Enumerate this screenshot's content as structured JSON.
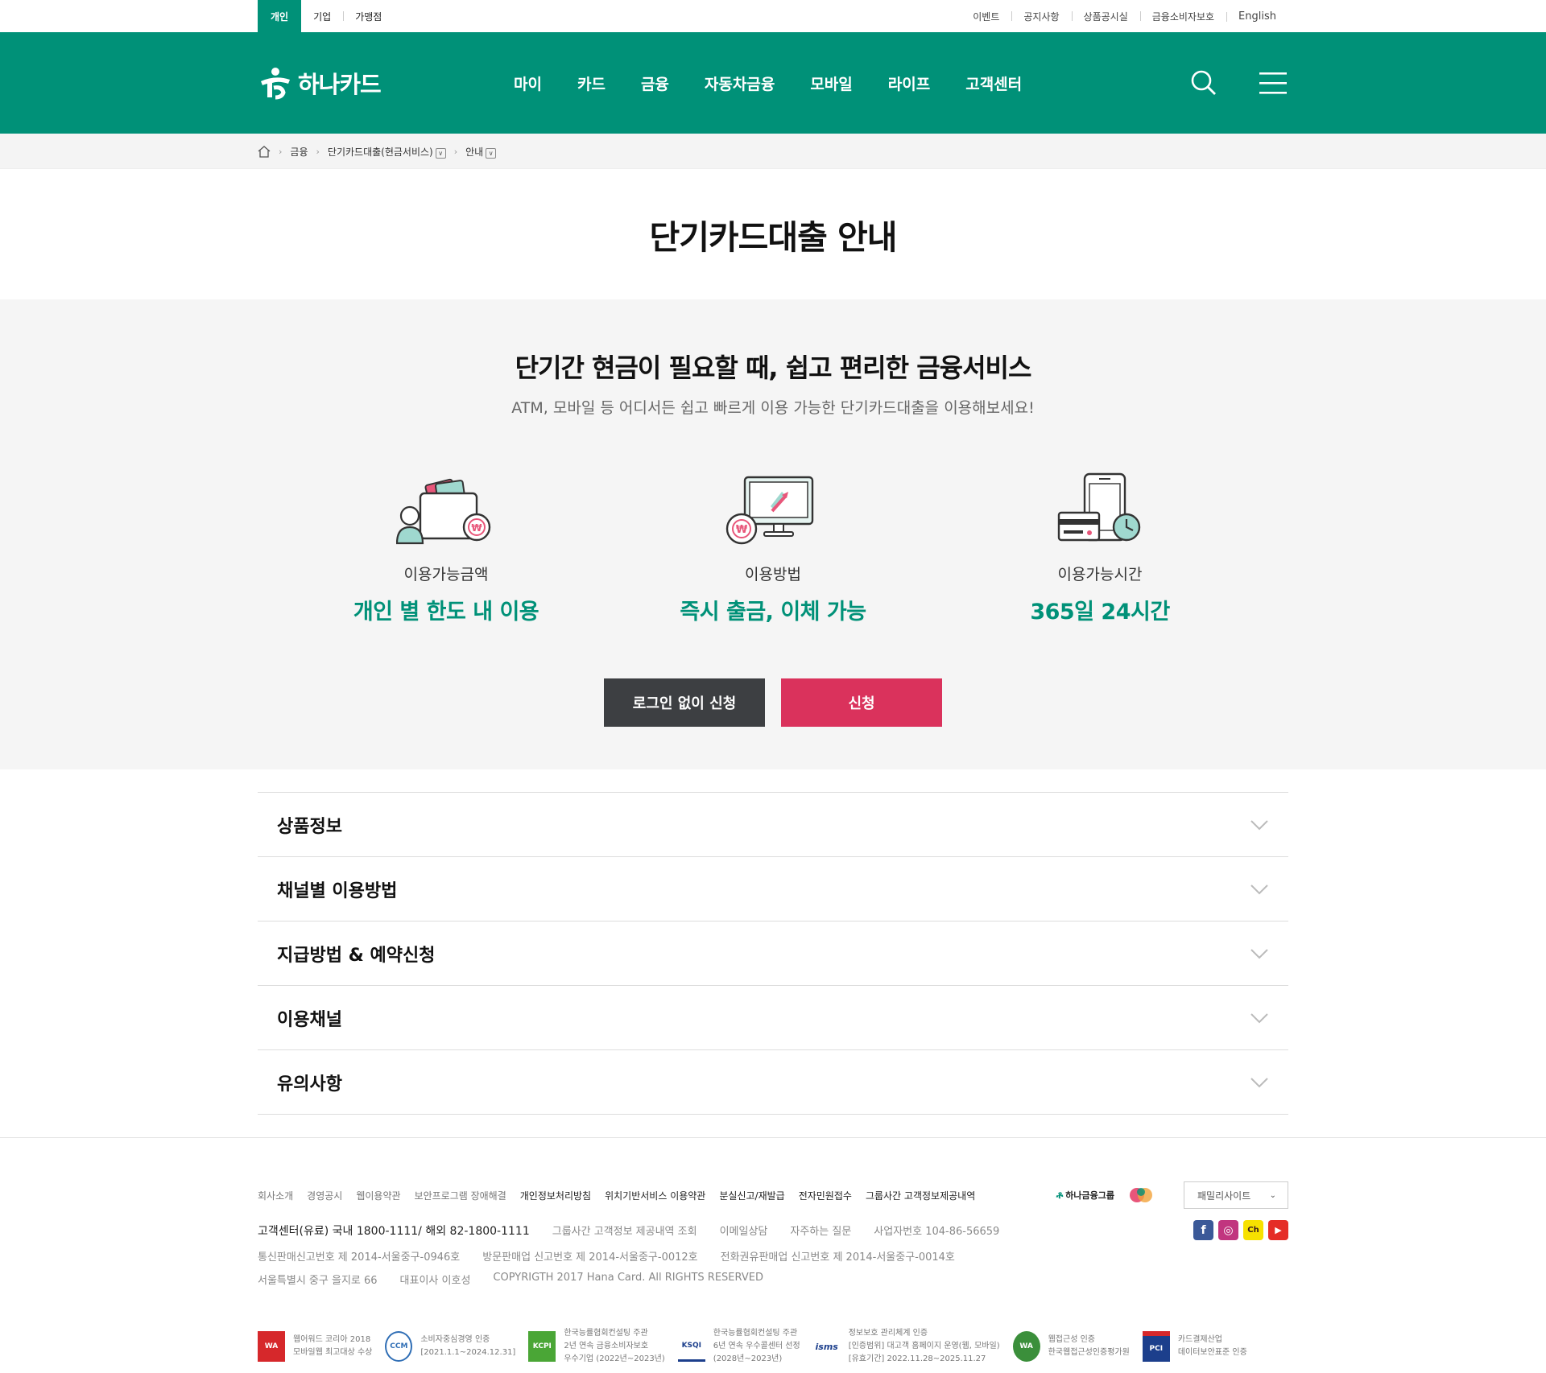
{
  "util": {
    "tabs": [
      "개인",
      "기업",
      "가맹점"
    ],
    "links": [
      "이벤트",
      "공지사항",
      "상품공시실",
      "금융소비자보호",
      "English"
    ]
  },
  "gnb": {
    "logo": "하나카드",
    "menu": [
      "마이",
      "카드",
      "금융",
      "자동차금융",
      "모바일",
      "라이프",
      "고객센터"
    ],
    "brand_color": "#009178"
  },
  "breadcrumb": [
    "금융",
    "단기카드대출(현금서비스)",
    "안내"
  ],
  "page_title": "단기카드대출 안내",
  "hero": {
    "title": "단기간 현금이 필요할 때, 쉽고 편리한 금융서비스",
    "subtitle": "ATM, 모바일 등 어디서든 쉽고 빠르게 이용 가능한 단기카드대출을 이용해보세요!",
    "features": [
      {
        "icon": "wallet-won-icon",
        "label": "이용가능금액",
        "value": "개인 별 한도 내 이용"
      },
      {
        "icon": "monitor-won-icon",
        "label": "이용방법",
        "value": "즉시 출금, 이체 가능"
      },
      {
        "icon": "mobile-clock-icon",
        "label": "이용가능시간",
        "value": "365일 24시간"
      }
    ],
    "btn_no_login": "로그인 없이 신청",
    "btn_apply": "신청",
    "accent_pink": "#da325c"
  },
  "accordion": [
    "상품정보",
    "채널별 이용방법",
    "지급방법 & 예약신청",
    "이용채널",
    "유의사항"
  ],
  "footer": {
    "links": [
      "회사소개",
      "경영공시",
      "웹이용약관",
      "보안프로그램 장애해결",
      "개인정보처리방침",
      "위치기반서비스 이용약관",
      "분실신고/재발급",
      "전자민원접수",
      "그룹사간 고객정보제공내역"
    ],
    "group_logo": "하나금융그룹",
    "family_site": "패밀리사이트",
    "customer_center": "고객센터(유료) 국내 1800-1111/ 해외 82-1800-1111",
    "info1": [
      "그룹사간 고객정보 제공내역 조회",
      "이메일상담",
      "자주하는 질문",
      "사업자번호 104-86-56659"
    ],
    "info2": [
      "통신판매신고번호 제 2014-서울중구-0946호",
      "방문판매업 신고번호 제 2014-서울중구-0012호",
      "전화권유판매업 신고번호 제 2014-서울중구-0014호"
    ],
    "info3": [
      "서울특별시 중구 을지로 66",
      "대표이사 이호성",
      "COPYRIGTH   2017 Hana Card. All RIGHTS RESERVED"
    ],
    "certs": [
      {
        "logo": "WA",
        "text": "웹어워드 코리아 2018\n모바일웹 최고대상 수상"
      },
      {
        "logo": "CCM",
        "text": "소비자중심경영 인증\n[2021.1.1~2024.12.31]"
      },
      {
        "logo": "KCPI",
        "text": "한국능률협회컨설팅 주관\n2년 연속 금융소비자보호\n우수기업 (2022년~2023년)"
      },
      {
        "logo": "KSQI",
        "text": "한국능률협회컨설팅 주관\n6년 연속 우수콜센터 선정\n(2028년~2023년)"
      },
      {
        "logo": "isms",
        "text": "정보보호 관리체계 인증\n[인증범위] 대고객 홈페이지 운영(웹, 모바일)\n[유효기간] 2022.11.28~2025.11.27"
      },
      {
        "logo": "WA",
        "text": "웹접근성 인증\n한국웹접근성인증평가원"
      },
      {
        "logo": "PCI",
        "text": "카드결제산업\n데이터보안표준 인증"
      }
    ]
  }
}
